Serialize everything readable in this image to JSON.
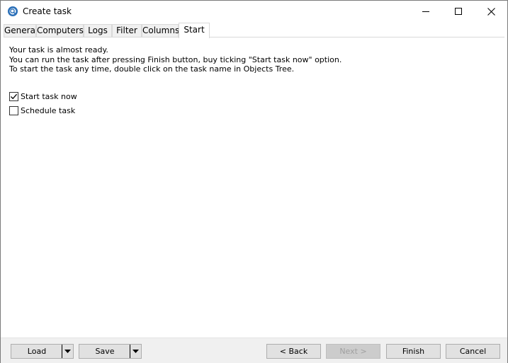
{
  "window": {
    "title": "Create task",
    "app_icon": "search-globe-icon"
  },
  "tabs": [
    {
      "label": "General"
    },
    {
      "label": "Computers"
    },
    {
      "label": "Logs"
    },
    {
      "label": "Filter"
    },
    {
      "label": "Columns"
    },
    {
      "label": "Start",
      "active": true
    }
  ],
  "content": {
    "intro": [
      "Your task is almost ready.",
      "You can run the task after pressing Finish button, buy ticking \"Start task now\" option.",
      "To start the task any time, double click on the task name in Objects Tree."
    ],
    "options": [
      {
        "label": "Start task now",
        "checked": true
      },
      {
        "label": "Schedule task",
        "checked": false
      }
    ]
  },
  "buttons": {
    "load": "Load",
    "save": "Save",
    "back": "< Back",
    "next": "Next >",
    "finish": "Finish",
    "cancel": "Cancel"
  }
}
